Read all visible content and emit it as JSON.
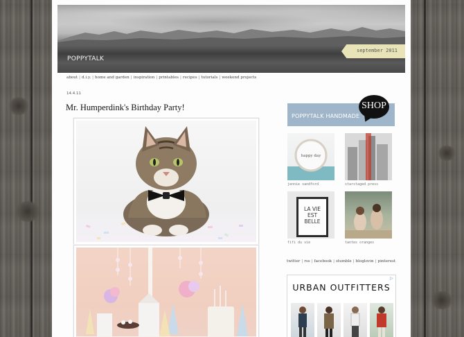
{
  "header": {
    "site_logo": "POPPYTALK",
    "date_tag": "september 2011"
  },
  "nav": {
    "items": [
      "about",
      "d.i.y.",
      "home and garden",
      "inspiration",
      "printables",
      "recipes",
      "tutorials",
      "weekend projects"
    ]
  },
  "post": {
    "date": "14.4.11",
    "title": "Mr. Humperdink's Birthday Party!"
  },
  "sidebar": {
    "shop_banner_title": "POPPYTALK HANDMADE",
    "shop_label": "SHOP",
    "shop_items": [
      {
        "caption": "jennie sandford"
      },
      {
        "caption": "starstaged press"
      },
      {
        "caption": "fifi du vie"
      },
      {
        "caption": "tantes oranges"
      }
    ],
    "shop_item_3_text": "LA VIE EST BELLE",
    "shop_item_1_text": "happy day",
    "social_links": [
      "twitter",
      "rss",
      "facebook",
      "stumble",
      "bloglovin",
      "pinterest"
    ],
    "ad_brand": "URBAN OUTFITTERS"
  },
  "colors": {
    "page_background": "#fdfdfd",
    "shop_banner": "#9fb5c9",
    "date_tag": "#e9e3b8",
    "wood": "#6d6862"
  }
}
